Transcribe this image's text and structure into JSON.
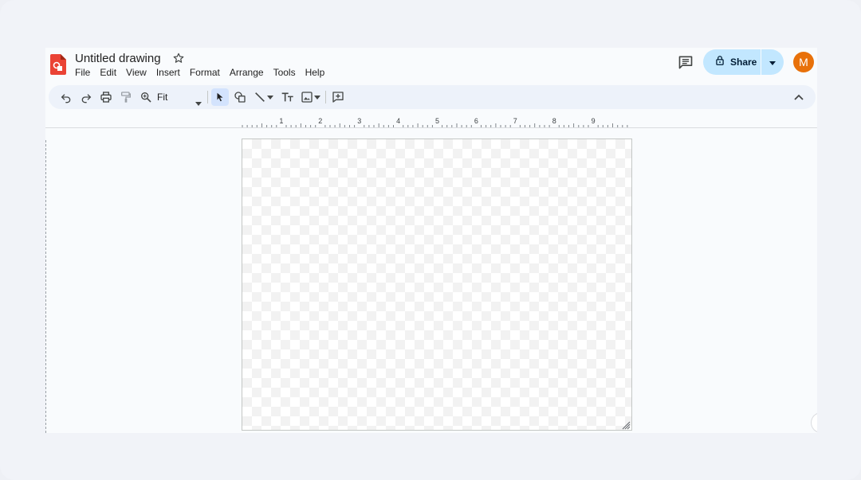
{
  "document": {
    "title": "Untitled drawing"
  },
  "menu": [
    "File",
    "Edit",
    "View",
    "Insert",
    "Format",
    "Arrange",
    "Tools",
    "Help"
  ],
  "share": {
    "label": "Share"
  },
  "user": {
    "initial": "M",
    "avatar_color": "#e8710a"
  },
  "toolbar": {
    "zoom_value": "Fit",
    "icons": [
      "undo-icon",
      "redo-icon",
      "print-icon",
      "paint-format-icon",
      "zoom-icon",
      "select-icon",
      "shape-icon",
      "line-icon",
      "text-box-icon",
      "image-icon",
      "comment-add-icon",
      "collapse-icon"
    ]
  },
  "ruler": {
    "labels": [
      "1",
      "2",
      "3",
      "4",
      "5",
      "6",
      "7",
      "8",
      "9"
    ]
  },
  "colors": {
    "accent": "#c2e7ff",
    "toolbar_bg": "#edf2fa",
    "logo": "#ea4335"
  }
}
